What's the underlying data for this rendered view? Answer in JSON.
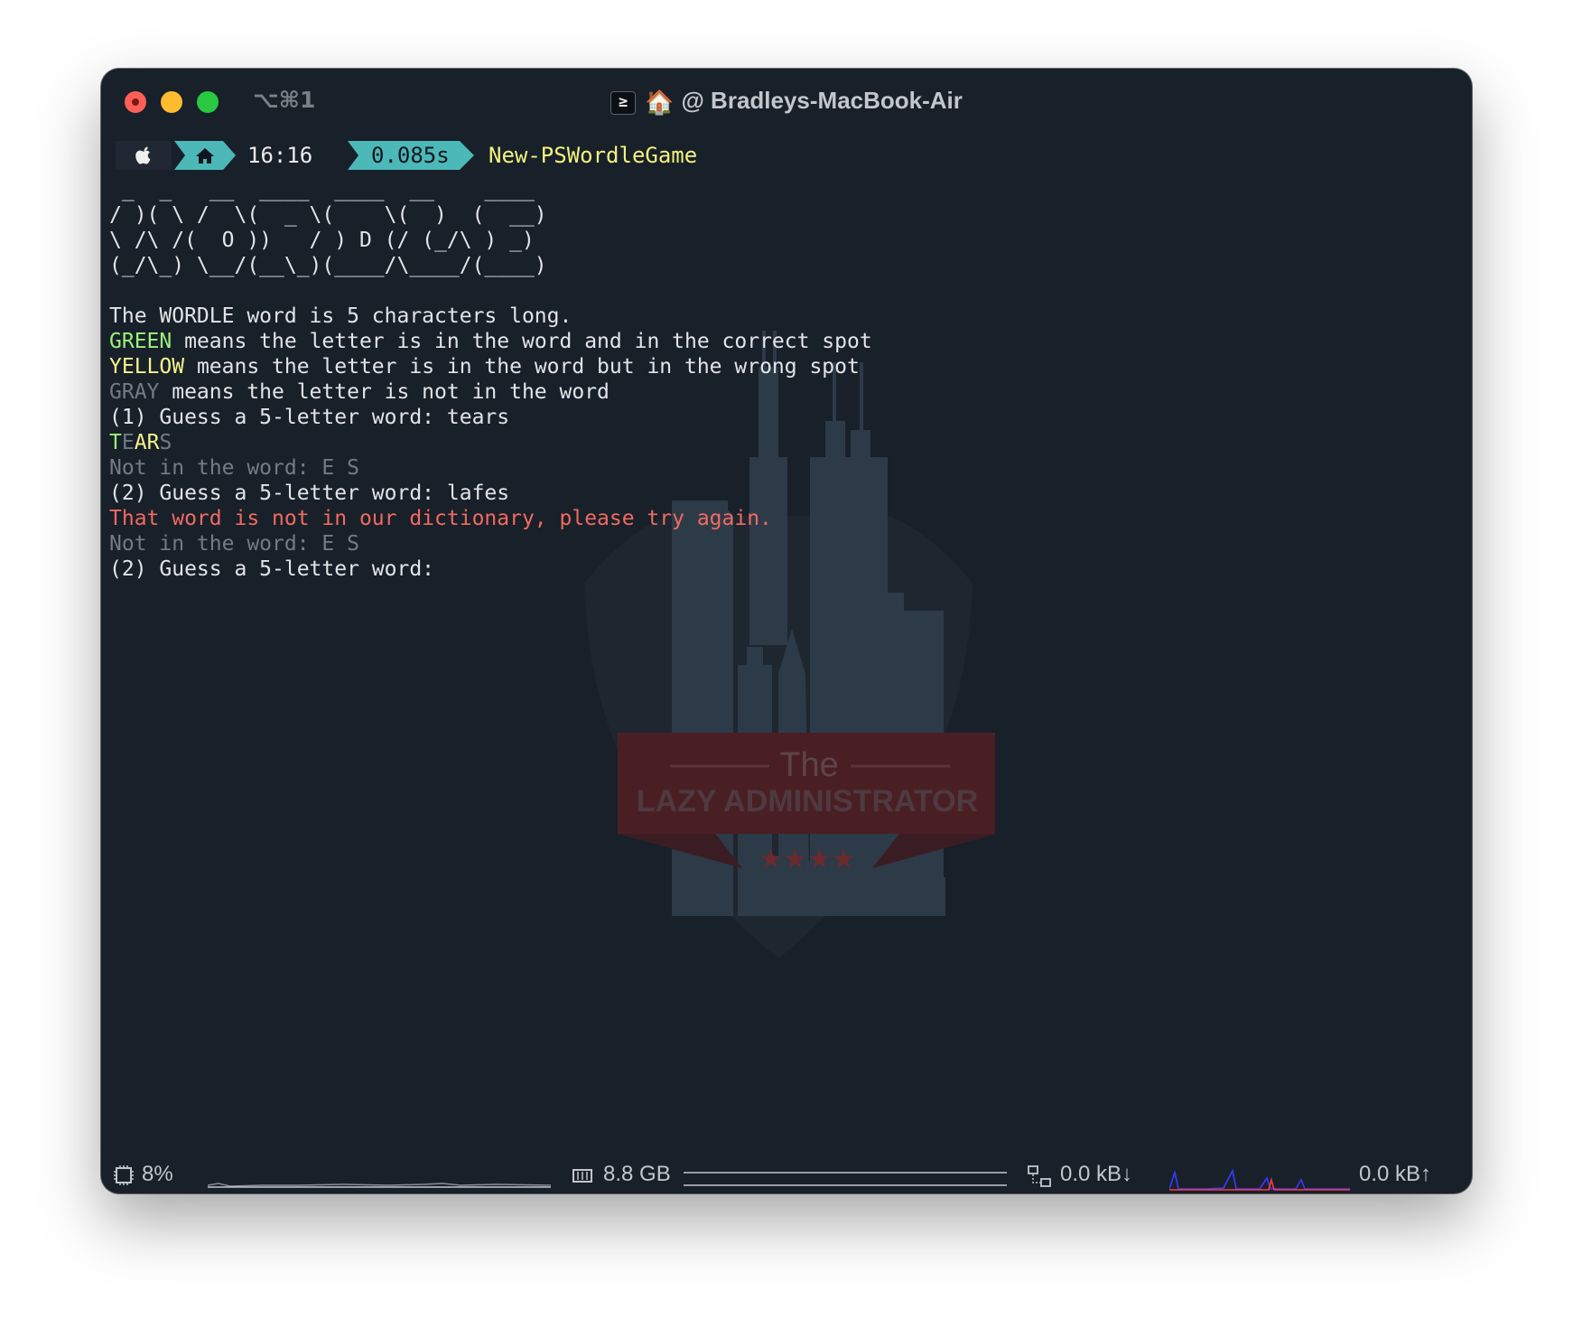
{
  "window": {
    "shortcut": "⌥⌘1",
    "title_emoji": "🏠",
    "title": "@ Bradleys-MacBook-Air"
  },
  "prompt": {
    "time": "16:16",
    "duration": "0.085s",
    "command": "New-PSWordleGame"
  },
  "terminal": {
    "ascii_art": " _  _   __  ____  ____  __    ____ \n/ )( \\ /  \\(  _ \\(    \\(  )  (  __)\n\\ /\\ /(  O ))   / ) D (/ (_/\\ ) _) \n(_/\\_) \\__/(__\\_)(____/\\____/(____)",
    "intro": "The WORDLE word is 5 characters long.",
    "green_word": "GREEN",
    "green_text": " means the letter is in the word and in the correct spot",
    "yellow_word": "YELLOW",
    "yellow_text": " means the letter is in the word but in the wrong spot",
    "gray_word": "GRAY",
    "gray_text": " means the letter is not in the word",
    "guess1": "(1) Guess a 5-letter word: tears",
    "tears": {
      "t": "T",
      "e": "E",
      "a": "A",
      "r": "R",
      "s": "S"
    },
    "not_in_word_1": "Not in the word: E S",
    "guess2": "(2) Guess a 5-letter word: lafes",
    "error": "That word is not in our dictionary, please try again.",
    "not_in_word_2": "Not in the word: E S",
    "guess2_retry": "(2) Guess a 5-letter word: "
  },
  "watermark": {
    "the": "The",
    "name": "LAZY ADMINISTRATOR",
    "stars": "★★★★"
  },
  "statusbar": {
    "cpu": "8%",
    "memory": "8.8 GB",
    "net_down": "0.0 kB↓",
    "net_up": "0.0 kB↑"
  },
  "colors": {
    "background": "#18202a",
    "accent_teal": "#4cb8b8",
    "green": "#9bf27a",
    "yellow": "#f5f58c",
    "gray": "#747b84",
    "red": "#f26a5f"
  }
}
